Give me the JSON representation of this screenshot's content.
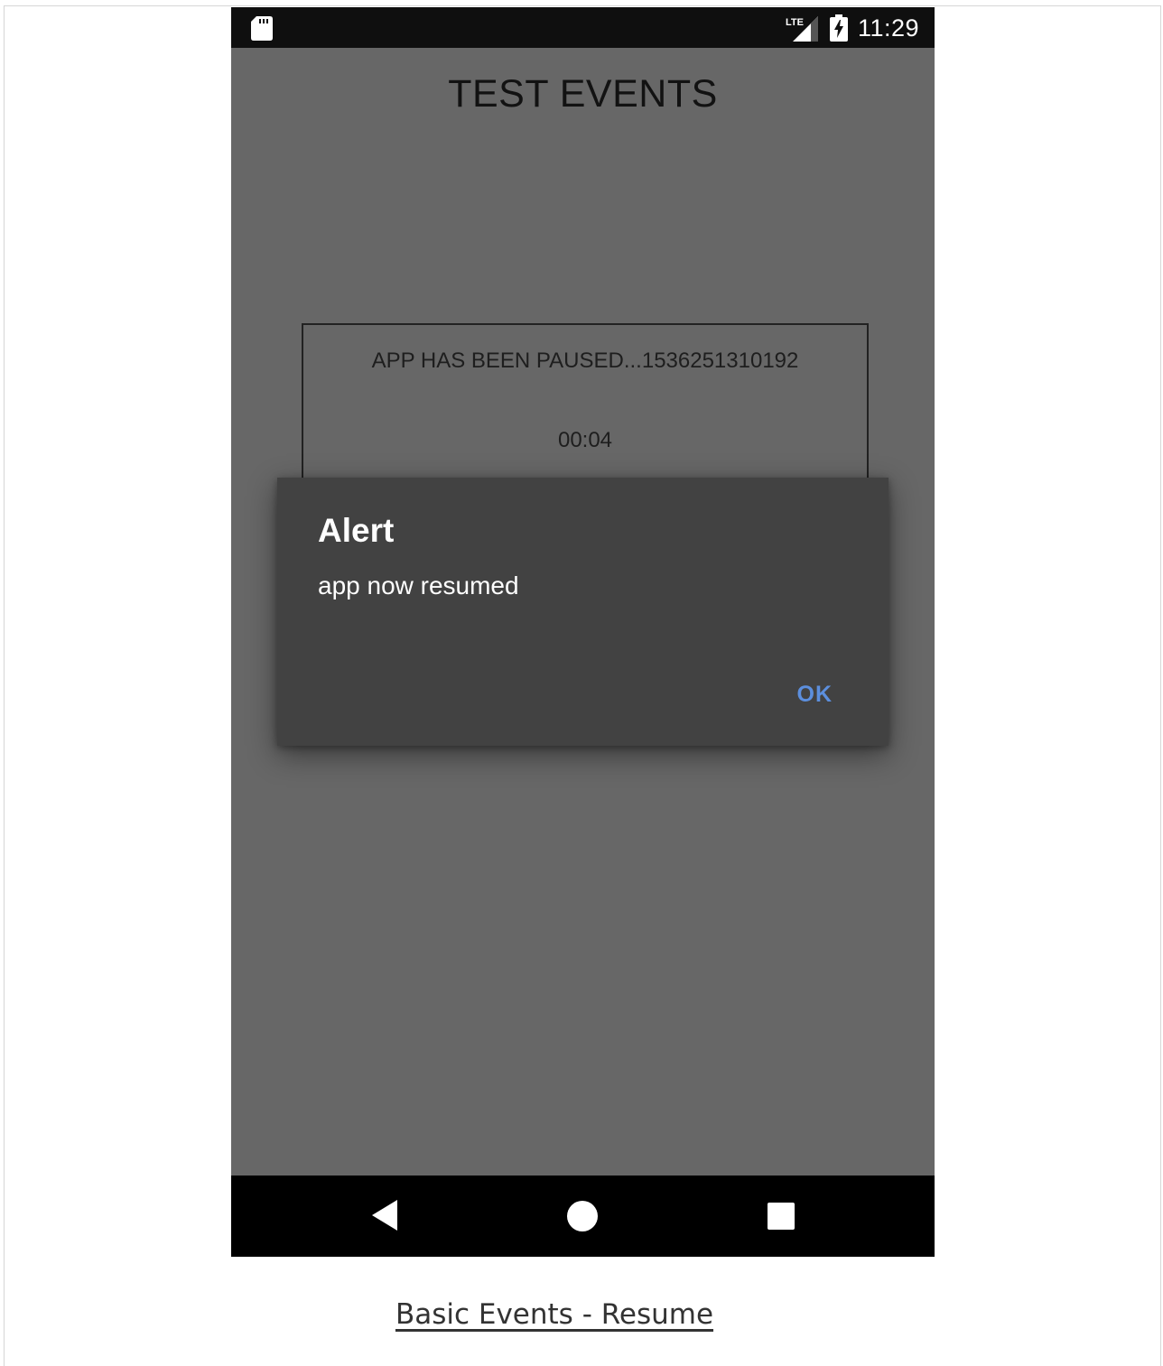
{
  "status_bar": {
    "time": "11:29",
    "network_label": "LTE",
    "icons": [
      "sd-card-icon",
      "lte-signal-icon",
      "battery-charging-icon"
    ]
  },
  "app": {
    "title": "TEST EVENTS",
    "event_text": "APP HAS BEEN PAUSED...1536251310192",
    "timer": "00:04"
  },
  "dialog": {
    "title": "Alert",
    "message": "app now resumed",
    "ok_label": "OK"
  },
  "nav_bar": {
    "icons": [
      "back-icon",
      "home-icon",
      "recents-icon"
    ]
  },
  "caption": {
    "text": "Basic Events - Resume"
  },
  "colors": {
    "app_background": "#676767",
    "status_bar": "#0f0f0f",
    "dialog_background": "#424242",
    "dialog_button": "#5c8fde",
    "nav_bar": "#000000"
  }
}
